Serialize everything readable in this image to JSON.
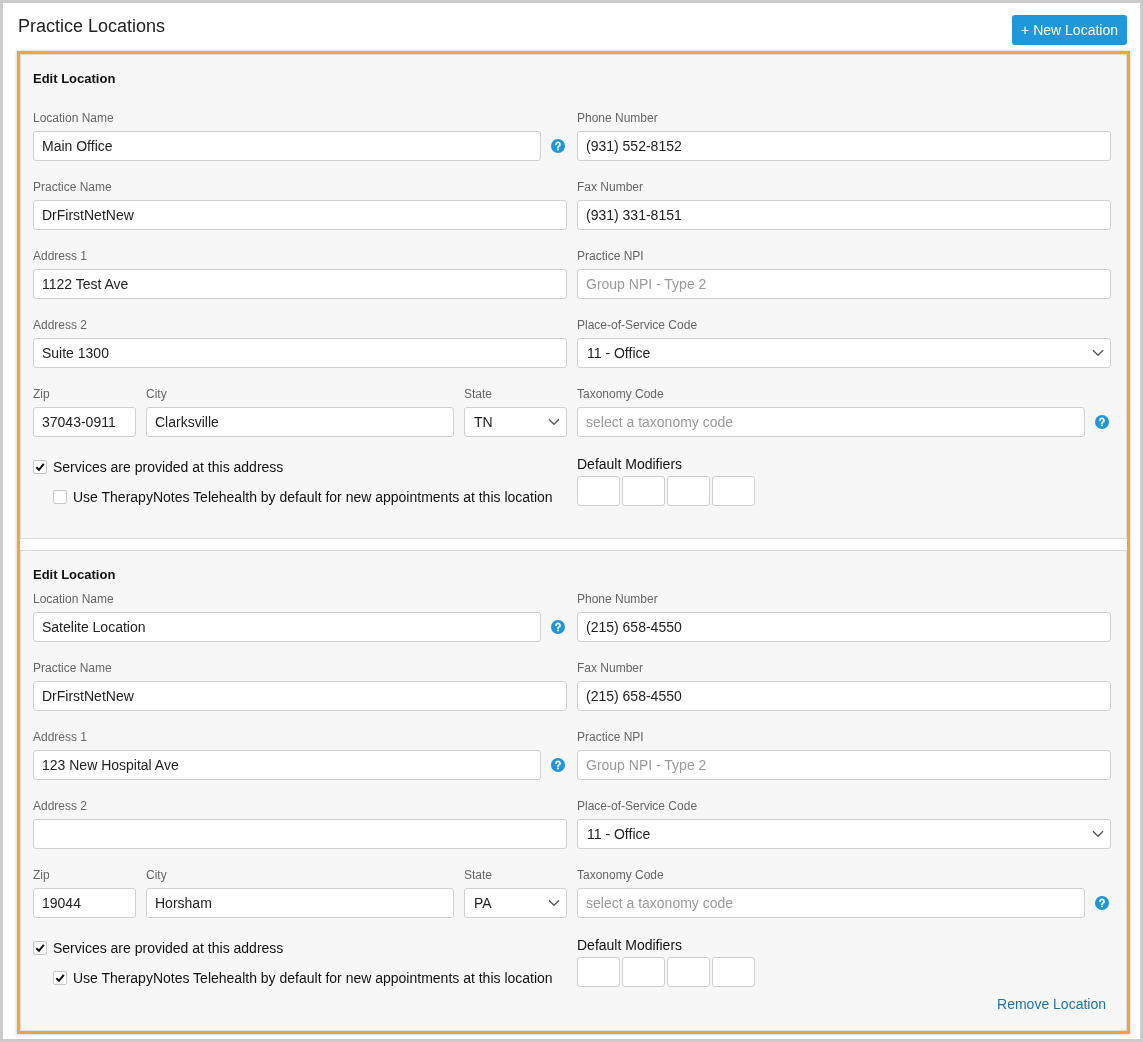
{
  "header": {
    "title": "Practice Locations",
    "new_location_button": "+ New Location"
  },
  "locations": [
    {
      "heading": "Edit Location",
      "left_fields": [
        {
          "kind": "text",
          "label": "Location Name",
          "value": "Main Office",
          "help": true
        },
        {
          "kind": "text",
          "label": "Practice Name",
          "value": "DrFirstNetNew",
          "help": false
        },
        {
          "kind": "text",
          "label": "Address 1",
          "value": "1122 Test Ave",
          "help": false
        },
        {
          "kind": "text",
          "label": "Address 2",
          "value": "Suite 1300",
          "help": false
        }
      ],
      "address_row": [
        {
          "kind": "text",
          "label": "Zip",
          "value": "37043-0911"
        },
        {
          "kind": "text",
          "label": "City",
          "value": "Clarksville"
        },
        {
          "kind": "select",
          "label": "State",
          "value": "TN"
        }
      ],
      "options": [
        {
          "label": "Services are provided at this address",
          "checked": true,
          "children": [
            {
              "label": "Use TherapyNotes Telehealth by default for new appointments at this location",
              "checked": false
            }
          ]
        }
      ],
      "right_fields": [
        {
          "kind": "text",
          "label": "Phone Number",
          "value": "(931) 552-8152",
          "help": false
        },
        {
          "kind": "text",
          "label": "Fax Number",
          "value": "(931) 331-8151",
          "help": false
        },
        {
          "kind": "text",
          "label": "Practice NPI",
          "placeholder": "Group NPI - Type 2",
          "help": false
        },
        {
          "kind": "select",
          "label": "Place-of-Service Code",
          "value": "11 - Office",
          "help": false
        },
        {
          "kind": "text",
          "label": "Taxonomy Code",
          "placeholder": "select a taxonomy code",
          "help": true
        }
      ],
      "modifiers": {
        "label": "Default Modifiers",
        "fields": [
          {
            "kind": "text"
          },
          {
            "kind": "text"
          },
          {
            "kind": "text"
          },
          {
            "kind": "text"
          }
        ]
      }
    },
    {
      "heading": "Edit Location",
      "left_fields": [
        {
          "kind": "text",
          "label": "Location Name",
          "value": "Satelite Location",
          "help": true
        },
        {
          "kind": "text",
          "label": "Practice Name",
          "value": "DrFirstNetNew",
          "help": false
        },
        {
          "kind": "text",
          "label": "Address 1",
          "value": "123 New Hospital Ave",
          "help": true
        },
        {
          "kind": "text",
          "label": "Address 2",
          "help": false
        }
      ],
      "address_row": [
        {
          "kind": "text",
          "label": "Zip",
          "value": "19044"
        },
        {
          "kind": "text",
          "label": "City",
          "value": "Horsham"
        },
        {
          "kind": "select",
          "label": "State",
          "value": "PA"
        }
      ],
      "options": [
        {
          "label": "Services are provided at this address",
          "checked": true,
          "children": [
            {
              "label": "Use TherapyNotes Telehealth by default for new appointments at this location",
              "checked": true
            }
          ]
        }
      ],
      "right_fields": [
        {
          "kind": "text",
          "label": "Phone Number",
          "value": "(215) 658-4550",
          "help": false
        },
        {
          "kind": "text",
          "label": "Fax Number",
          "value": "(215) 658-4550",
          "help": false
        },
        {
          "kind": "text",
          "label": "Practice NPI",
          "placeholder": "Group NPI - Type 2",
          "help": false
        },
        {
          "kind": "select",
          "label": "Place-of-Service Code",
          "value": "11 - Office",
          "help": false
        },
        {
          "kind": "text",
          "label": "Taxonomy Code",
          "placeholder": "select a taxonomy code",
          "help": true
        }
      ],
      "modifiers": {
        "label": "Default Modifiers",
        "fields": [
          {
            "kind": "text"
          },
          {
            "kind": "text"
          },
          {
            "kind": "text"
          },
          {
            "kind": "text"
          }
        ]
      },
      "remove_link": "Remove Location"
    }
  ]
}
